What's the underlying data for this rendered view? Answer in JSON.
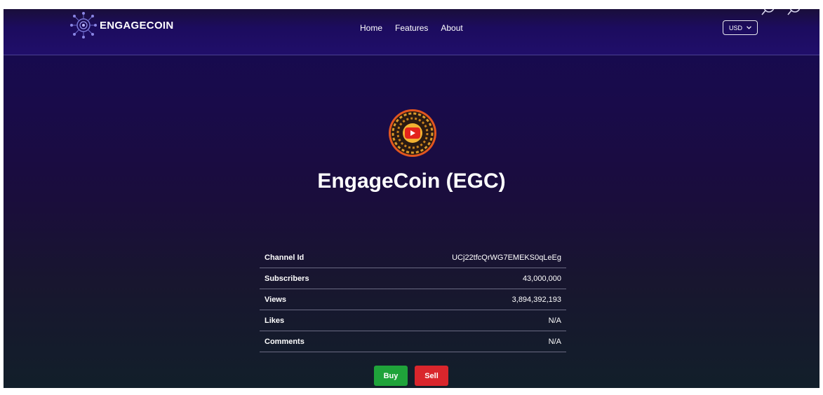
{
  "brand": {
    "name": "ENGAGECOIN"
  },
  "nav": {
    "items": [
      {
        "label": "Home"
      },
      {
        "label": "Features"
      },
      {
        "label": "About"
      }
    ]
  },
  "currency": {
    "selected": "USD"
  },
  "coin": {
    "title": "EngageCoin (EGC)"
  },
  "stats": [
    {
      "label": "Channel Id",
      "value": "UCj22tfcQrWG7EMEKS0qLeEg"
    },
    {
      "label": "Subscribers",
      "value": "43,000,000"
    },
    {
      "label": "Views",
      "value": "3,894,392,193"
    },
    {
      "label": "Likes",
      "value": "N/A"
    },
    {
      "label": "Comments",
      "value": "N/A"
    }
  ],
  "actions": {
    "buy_label": "Buy",
    "sell_label": "Sell"
  },
  "icons": {
    "brand_logo": "network-globe-icon",
    "coin_logo": "youtube-coin-icon",
    "dropdown": "chevron-down-icon",
    "corner_left": "search-icon",
    "corner_right": "search-icon"
  },
  "colors": {
    "buy": "#1fa33a",
    "sell": "#d9262c",
    "header": "#1c0c5e"
  }
}
